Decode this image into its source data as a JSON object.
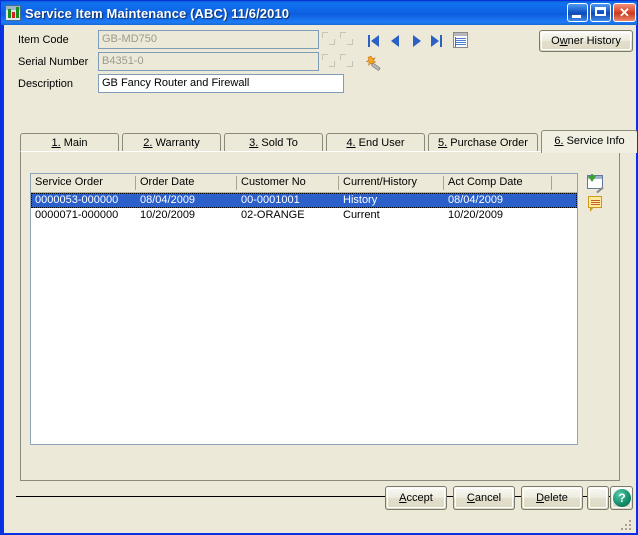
{
  "window": {
    "title": "Service Item Maintenance (ABC) 11/6/2010",
    "app_icon": "sage-mas-icon",
    "minimize_label": "",
    "maximize_label": "",
    "close_label": "✕"
  },
  "header_form": {
    "fields": [
      {
        "label": "Item Code",
        "value": "GB-MD750",
        "placeholder": "",
        "disabled": true
      },
      {
        "label": "Serial Number",
        "value": "B4351-0",
        "placeholder": "",
        "disabled": true
      },
      {
        "label": "Description",
        "value": "GB Fancy Router and Firewall",
        "placeholder": "",
        "disabled": false
      }
    ],
    "nav": {
      "first_label": "",
      "prev_label": "",
      "next_label": "",
      "last_label": "",
      "memo_label": ""
    },
    "wand_label": "",
    "owner_history_label": "Owner History",
    "owner_history_accel": "w"
  },
  "tabs": [
    {
      "num": "1.",
      "label": " Main",
      "active": false
    },
    {
      "num": "2.",
      "label": " Warranty",
      "active": false
    },
    {
      "num": "3.",
      "label": " Sold To",
      "active": false
    },
    {
      "num": "4.",
      "label": " End User",
      "active": false
    },
    {
      "num": "5.",
      "label": " Purchase Order",
      "active": false
    },
    {
      "num": "6.",
      "label": " Service Info",
      "active": true
    }
  ],
  "grid": {
    "columns": [
      {
        "header": "Service Order"
      },
      {
        "header": "Order Date"
      },
      {
        "header": "Customer No"
      },
      {
        "header": "Current/History"
      },
      {
        "header": "Act Comp Date"
      },
      {
        "header": ""
      }
    ],
    "rows": [
      {
        "selected": true,
        "cells": [
          "0000053-000000",
          "08/04/2009",
          "00-0001001",
          "History",
          "08/04/2009",
          ""
        ]
      },
      {
        "selected": false,
        "cells": [
          "0000071-000000",
          "10/20/2009",
          "02-ORANGE",
          "Current",
          "10/20/2009",
          ""
        ]
      }
    ]
  },
  "side_icons": [
    {
      "name": "drill-down-icon",
      "label": ""
    },
    {
      "name": "comment-memo-icon",
      "label": ""
    }
  ],
  "footer": {
    "accept_label": "Accept",
    "accept_accel": "A",
    "cancel_label": "Cancel",
    "cancel_accel": "C",
    "delete_label": "Delete",
    "delete_accel": "D",
    "blank_label": "",
    "help_label": "?"
  },
  "colors": {
    "titlebar_blue": "#0d63e4",
    "window_face": "#ece9d8",
    "selection_blue": "#2b5fc9",
    "field_border": "#7f9db9",
    "disabled_text": "#9a9a8e"
  }
}
